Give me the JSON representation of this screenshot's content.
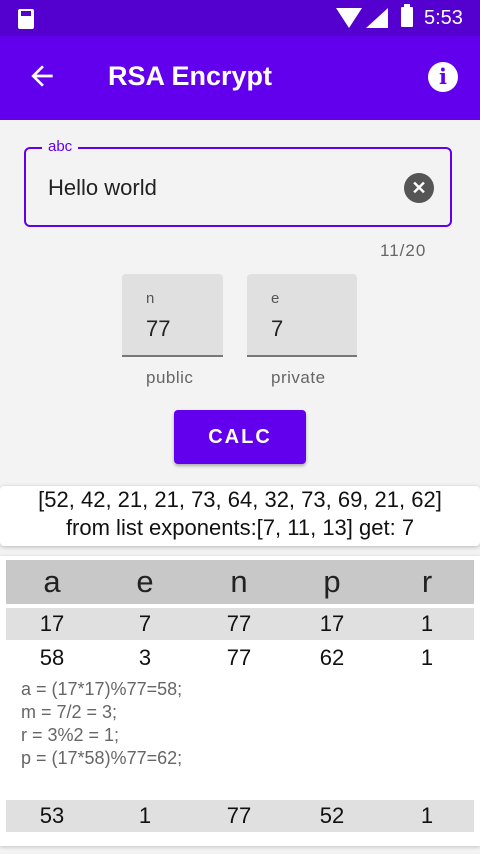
{
  "status_bar": {
    "time": "5:53"
  },
  "app_bar": {
    "title": "RSA Encrypt",
    "back_icon": "arrow-back-icon",
    "info_icon": "info-icon"
  },
  "input": {
    "label": "abc",
    "value": "Hello world",
    "counter": "11/20",
    "clear_icon": "clear-circle-icon"
  },
  "fields": {
    "n": {
      "label": "n",
      "value": "77",
      "helper": "public"
    },
    "e": {
      "label": "e",
      "value": "7",
      "helper": "private"
    }
  },
  "calc_button": {
    "label": "CALC"
  },
  "result": {
    "line1": "[52, 42, 21, 21, 73, 64, 32, 73, 69, 21, 62]",
    "line2": "from list exponents:[7, 11, 13] get: 7"
  },
  "table": {
    "headers": [
      "a",
      "e",
      "n",
      "p",
      "r"
    ],
    "rows": [
      [
        "17",
        "7",
        "77",
        "17",
        "1"
      ],
      [
        "58",
        "3",
        "77",
        "62",
        "1"
      ],
      [
        "53",
        "1",
        "77",
        "52",
        "1"
      ]
    ],
    "steps": [
      "a = (17*17)%77=58;",
      "m = 7/2 = 3;",
      "r = 3%2 = 1;",
      "p = (17*58)%77=62;"
    ]
  },
  "colors": {
    "primary": "#6200ee",
    "status_bar": "#5400cf",
    "header_row": "#c8c8c8",
    "alt_row": "#e0e0e0"
  }
}
